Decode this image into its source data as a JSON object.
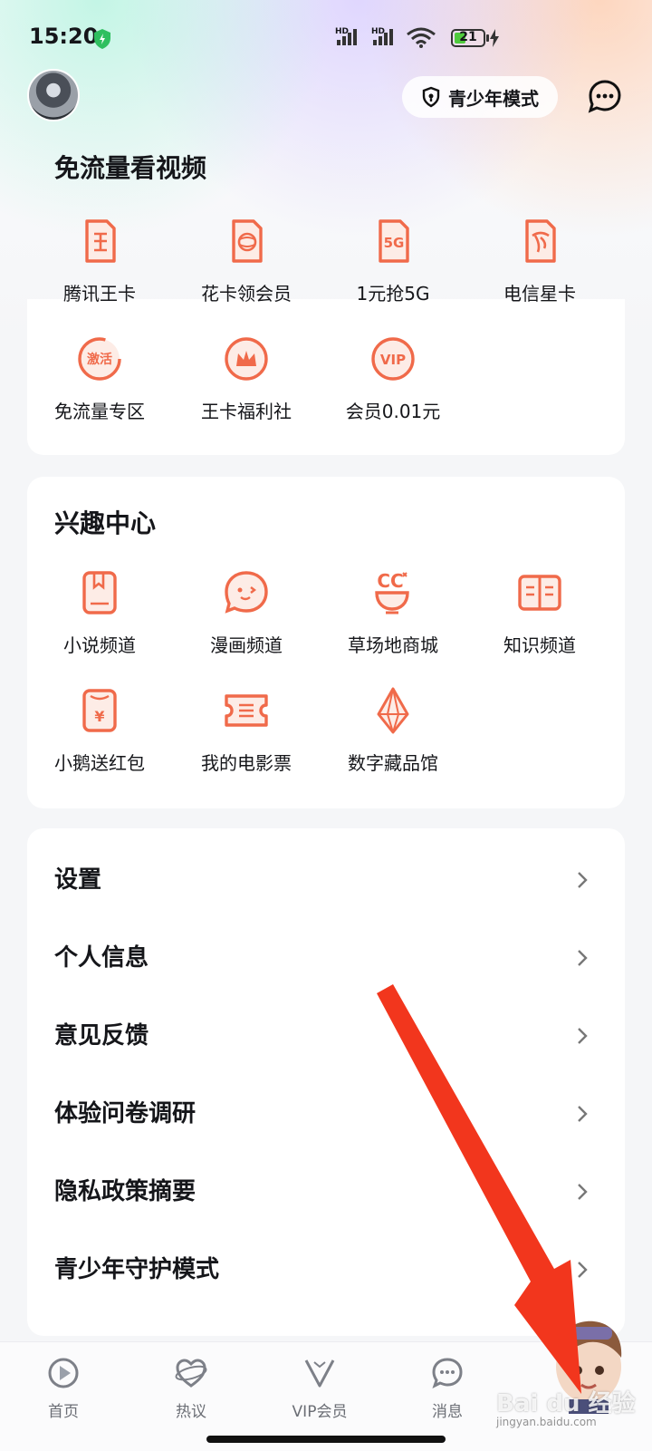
{
  "status_bar": {
    "time": "15:20",
    "hd1": "HD",
    "hd2": "HD",
    "battery": "21"
  },
  "header": {
    "teen_mode_label": "青少年模式"
  },
  "free_data_section": {
    "title": "免流量看视频",
    "items": [
      {
        "label": "腾讯王卡",
        "icon": "wangka-sim-icon"
      },
      {
        "label": "花卡领会员",
        "icon": "huaka-sim-icon"
      },
      {
        "label": "1元抢5G",
        "icon": "5g-sim-icon"
      },
      {
        "label": "电信星卡",
        "icon": "telecom-sim-icon"
      },
      {
        "label": "免流量专区",
        "icon": "activate-icon"
      },
      {
        "label": "王卡福利社",
        "icon": "crown-icon"
      },
      {
        "label": "会员0.01元",
        "icon": "vip-icon"
      }
    ]
  },
  "interest_section": {
    "title": "兴趣中心",
    "items": [
      {
        "label": "小说频道",
        "icon": "book-icon"
      },
      {
        "label": "漫画频道",
        "icon": "comic-face-icon"
      },
      {
        "label": "草场地商城",
        "icon": "shop-cc-icon"
      },
      {
        "label": "知识频道",
        "icon": "knowledge-icon"
      },
      {
        "label": "小鹅送红包",
        "icon": "red-packet-icon"
      },
      {
        "label": "我的电影票",
        "icon": "ticket-icon"
      },
      {
        "label": "数字藏品馆",
        "icon": "diamond-icon"
      }
    ]
  },
  "menu": {
    "items": [
      {
        "label": "设置"
      },
      {
        "label": "个人信息"
      },
      {
        "label": "意见反馈"
      },
      {
        "label": "体验问卷调研"
      },
      {
        "label": "隐私政策摘要"
      },
      {
        "label": "青少年守护模式"
      }
    ]
  },
  "tabbar": {
    "tabs": [
      {
        "label": "首页"
      },
      {
        "label": "热议"
      },
      {
        "label": "VIP会员"
      },
      {
        "label": "消息"
      }
    ]
  },
  "watermark": {
    "text": "Bai du 经验",
    "sub": "jingyan.baidu.com"
  },
  "colors": {
    "accent": "#f06a4a",
    "arrow": "#f2361d",
    "text": "#15161a"
  }
}
